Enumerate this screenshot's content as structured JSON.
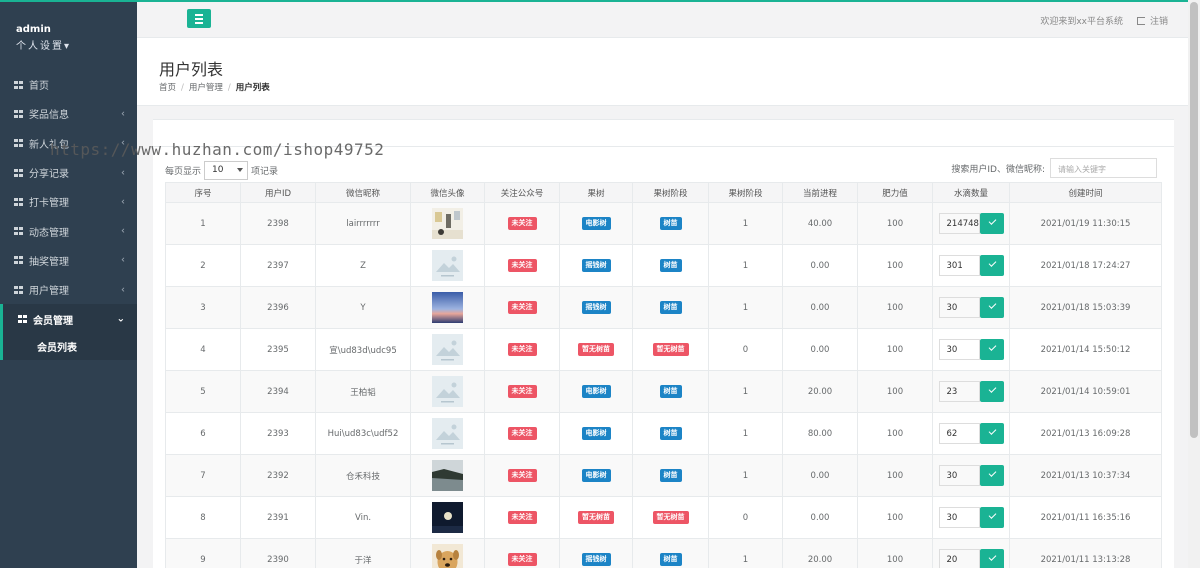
{
  "sidebar": {
    "username": "admin",
    "role_label": "个人设置▾",
    "items": [
      {
        "label": "首页",
        "arrow": ""
      },
      {
        "label": "奖品信息",
        "arrow": "‹"
      },
      {
        "label": "新人礼包",
        "arrow": "‹"
      },
      {
        "label": "分享记录",
        "arrow": "‹"
      },
      {
        "label": "打卡管理",
        "arrow": "‹"
      },
      {
        "label": "动态管理",
        "arrow": "‹"
      },
      {
        "label": "抽奖管理",
        "arrow": "‹"
      },
      {
        "label": "用户管理",
        "arrow": "‹"
      },
      {
        "label": "会员管理",
        "arrow": "⌄"
      }
    ],
    "sub_item": "会员列表"
  },
  "topbar": {
    "welcome": "欢迎来到xx平台系统",
    "logout": "注销"
  },
  "page": {
    "title": "用户列表",
    "breadcrumb": [
      "首页",
      "用户管理",
      "用户列表"
    ]
  },
  "table_controls": {
    "per_page_prefix": "每页显示",
    "per_page_value": "10",
    "per_page_suffix": "项记录",
    "search_label": "搜索用户ID、微信昵称:",
    "search_placeholder": "请输入关键字"
  },
  "watermark": "https://www.huzhan.com/ishop49752",
  "table": {
    "headers": [
      "序号",
      "用户ID",
      "微信昵称",
      "微信头像",
      "关注公众号",
      "果树",
      "果树阶段",
      "果树阶段",
      "当前进程",
      "肥力值",
      "水滴数量",
      "创建时间"
    ],
    "rows": [
      {
        "no": "1",
        "uid": "2398",
        "nick": "lairrrrrrr",
        "avatar": "photo-white",
        "follow": "未关注",
        "tree": "电影树",
        "tree_color": "blue",
        "stage": "树苗",
        "stage_color": "blue",
        "stage_num": "1",
        "progress": "40.00",
        "fert": "100",
        "water": "214748",
        "time": "2021/01/19 11:30:15"
      },
      {
        "no": "2",
        "uid": "2397",
        "nick": "Z",
        "avatar": "placeholder",
        "follow": "未关注",
        "tree": "摇钱树",
        "tree_color": "blue",
        "stage": "树苗",
        "stage_color": "blue",
        "stage_num": "1",
        "progress": "0.00",
        "fert": "100",
        "water": "301",
        "time": "2021/01/18 17:24:27"
      },
      {
        "no": "3",
        "uid": "2396",
        "nick": "Y",
        "avatar": "photo-sky",
        "follow": "未关注",
        "tree": "摇钱树",
        "tree_color": "blue",
        "stage": "树苗",
        "stage_color": "blue",
        "stage_num": "1",
        "progress": "0.00",
        "fert": "100",
        "water": "30",
        "time": "2021/01/18 15:03:39"
      },
      {
        "no": "4",
        "uid": "2395",
        "nick": "宣\\ud83d\\udc95",
        "avatar": "placeholder",
        "follow": "未关注",
        "tree": "暂无树苗",
        "tree_color": "red",
        "stage": "暂无树苗",
        "stage_color": "red",
        "stage_num": "0",
        "progress": "0.00",
        "fert": "100",
        "water": "30",
        "time": "2021/01/14 15:50:12"
      },
      {
        "no": "5",
        "uid": "2394",
        "nick": "王柏韬",
        "avatar": "placeholder",
        "follow": "未关注",
        "tree": "电影树",
        "tree_color": "blue",
        "stage": "树苗",
        "stage_color": "blue",
        "stage_num": "1",
        "progress": "20.00",
        "fert": "100",
        "water": "23",
        "time": "2021/01/14 10:59:01"
      },
      {
        "no": "6",
        "uid": "2393",
        "nick": "Hui\\ud83c\\udf52",
        "avatar": "placeholder",
        "follow": "未关注",
        "tree": "电影树",
        "tree_color": "blue",
        "stage": "树苗",
        "stage_color": "blue",
        "stage_num": "1",
        "progress": "80.00",
        "fert": "100",
        "water": "62",
        "time": "2021/01/13 16:09:28"
      },
      {
        "no": "7",
        "uid": "2392",
        "nick": "仓禾科技",
        "avatar": "photo-lake",
        "follow": "未关注",
        "tree": "电影树",
        "tree_color": "blue",
        "stage": "树苗",
        "stage_color": "blue",
        "stage_num": "1",
        "progress": "0.00",
        "fert": "100",
        "water": "30",
        "time": "2021/01/13 10:37:34"
      },
      {
        "no": "8",
        "uid": "2391",
        "nick": "Vin.",
        "avatar": "photo-night",
        "follow": "未关注",
        "tree": "暂无树苗",
        "tree_color": "red",
        "stage": "暂无树苗",
        "stage_color": "red",
        "stage_num": "0",
        "progress": "0.00",
        "fert": "100",
        "water": "30",
        "time": "2021/01/11 16:35:16"
      },
      {
        "no": "9",
        "uid": "2390",
        "nick": "于洋",
        "avatar": "photo-dog",
        "follow": "未关注",
        "tree": "摇钱树",
        "tree_color": "blue",
        "stage": "树苗",
        "stage_color": "blue",
        "stage_num": "1",
        "progress": "20.00",
        "fert": "100",
        "water": "20",
        "time": "2021/01/11 13:13:28"
      }
    ]
  }
}
